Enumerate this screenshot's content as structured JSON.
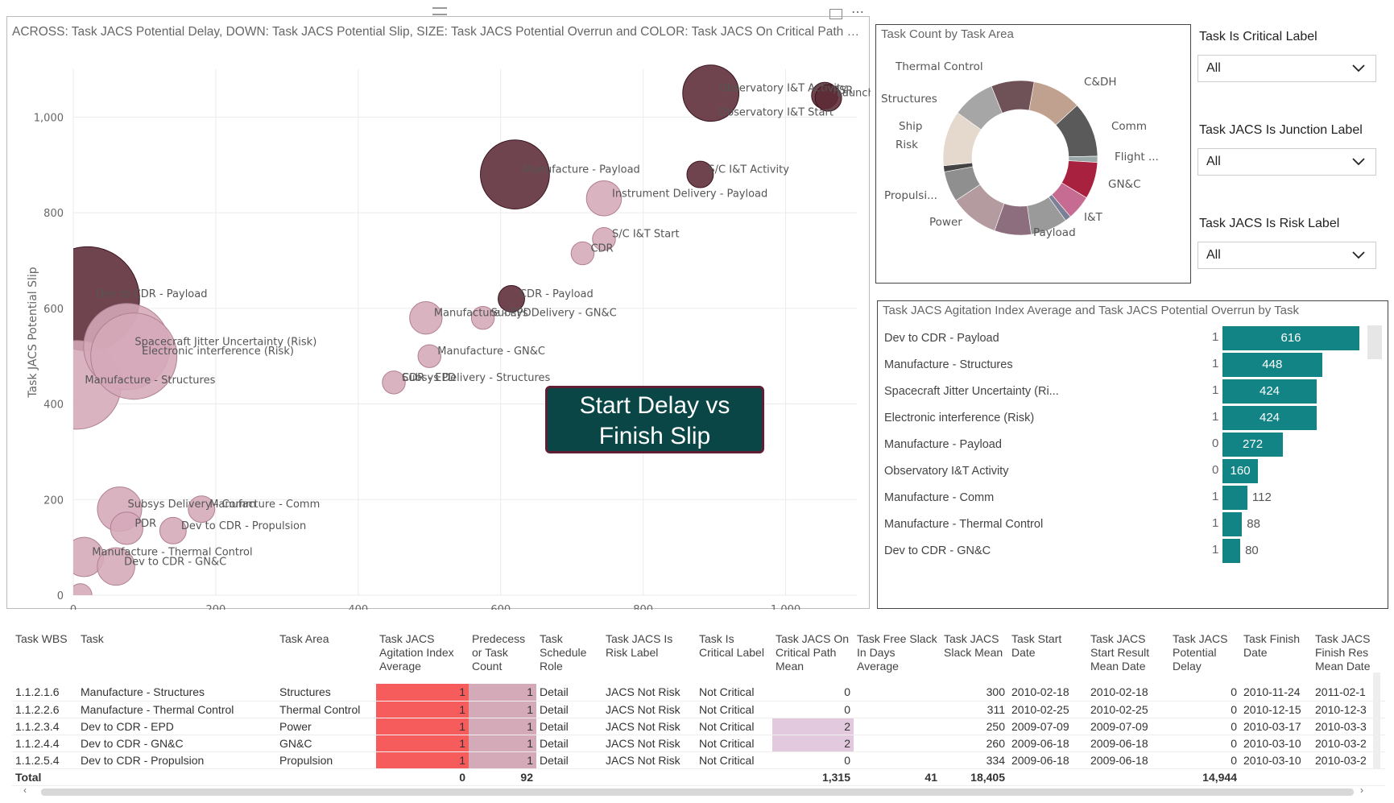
{
  "scatter": {
    "title": "ACROSS: Task JACS Potential Delay, DOWN: Task JACS Potential Slip, SIZE: Task JACS Potential Overrun and COLOR: Task JACS On Critical Path Me...",
    "xlabel": "Task JACS Potential Delay",
    "ylabel": "Task JACS Potential Slip",
    "x_ticks": [
      "0",
      "200",
      "400",
      "600",
      "800",
      "1,000"
    ],
    "y_ticks": [
      "0",
      "200",
      "400",
      "600",
      "800",
      "1,000"
    ],
    "callout_line1": "Start Delay vs",
    "callout_line2": "Finish Slip"
  },
  "chart_data": [
    {
      "type": "scatter",
      "title": "ACROSS: Task JACS Potential Delay, DOWN: Task JACS Potential Slip, SIZE: Task JACS Potential Overrun and COLOR: Task JACS On Critical Path Me...",
      "xlabel": "Task JACS Potential Delay",
      "ylabel": "Task JACS Potential Slip",
      "xlim": [
        0,
        1100
      ],
      "ylim": [
        0,
        1100
      ],
      "points": [
        {
          "label": "Dev to CDR - Payload",
          "x": 20,
          "y": 620,
          "size": 616,
          "color": "#5c2a36"
        },
        {
          "label": "Spacecraft Jitter Uncertainty (Risk)",
          "x": 75,
          "y": 520,
          "size": 424,
          "color": "#d5a8b8"
        },
        {
          "label": "Electronic interference (Risk)",
          "x": 85,
          "y": 500,
          "size": 424,
          "color": "#d5a8b8"
        },
        {
          "label": "Manufacture - Structures",
          "x": 5,
          "y": 440,
          "size": 448,
          "color": "#d5a8b8"
        },
        {
          "label": "Manufacture - Payload",
          "x": 620,
          "y": 880,
          "size": 272,
          "color": "#5c2a36"
        },
        {
          "label": "Observatory I&T Activity",
          "x": 895,
          "y": 1050,
          "size": 180,
          "color": "#5c2a36"
        },
        {
          "label": "Observatory I&T Start",
          "x": 895,
          "y": 1000,
          "size": 0,
          "color": "#5c2a36"
        },
        {
          "label": "PSR",
          "x": 1055,
          "y": 1045,
          "size": 40,
          "color": "#5c2a36"
        },
        {
          "label": "Launch",
          "x": 1060,
          "y": 1040,
          "size": 40,
          "color": "#5c2a36"
        },
        {
          "label": "S/C I&T Activity",
          "x": 880,
          "y": 880,
          "size": 40,
          "color": "#5c2a36"
        },
        {
          "label": "Instrument Delivery - Payload",
          "x": 745,
          "y": 830,
          "size": 70,
          "color": "#d5a8b8"
        },
        {
          "label": "S/C I&T Start",
          "x": 745,
          "y": 745,
          "size": 30,
          "color": "#d5a8b8"
        },
        {
          "label": "CDR",
          "x": 715,
          "y": 715,
          "size": 30,
          "color": "#d5a8b8"
        },
        {
          "label": "CDR - Payload",
          "x": 615,
          "y": 620,
          "size": 40,
          "color": "#5c2a36"
        },
        {
          "label": "Subsys Delivery - GN&C",
          "x": 575,
          "y": 580,
          "size": 30,
          "color": "#d5a8b8"
        },
        {
          "label": "Manufacture - EPD",
          "x": 495,
          "y": 580,
          "size": 60,
          "color": "#d5a8b8"
        },
        {
          "label": "Manufacture - GN&C",
          "x": 500,
          "y": 500,
          "size": 30,
          "color": "#d5a8b8"
        },
        {
          "label": "CDR - EPD",
          "x": 450,
          "y": 445,
          "size": 30,
          "color": "#d5a8b8"
        },
        {
          "label": "Subsys Delivery - Structures",
          "x": 450,
          "y": 445,
          "size": 0,
          "color": "#d5a8b8"
        },
        {
          "label": "Subsys Delivery - Comm",
          "x": 65,
          "y": 180,
          "size": 112,
          "color": "#d5a8b8"
        },
        {
          "label": "PDR",
          "x": 75,
          "y": 140,
          "size": 60,
          "color": "#d5a8b8"
        },
        {
          "label": "Manufacture - Comm",
          "x": 180,
          "y": 180,
          "size": 40,
          "color": "#d5a8b8"
        },
        {
          "label": "Dev to CDR - Propulsion",
          "x": 140,
          "y": 135,
          "size": 40,
          "color": "#d5a8b8"
        },
        {
          "label": "Manufacture - Thermal Control",
          "x": 15,
          "y": 80,
          "size": 88,
          "color": "#d5a8b8"
        },
        {
          "label": "Dev to CDR - GN&C",
          "x": 60,
          "y": 60,
          "size": 80,
          "color": "#d5a8b8"
        },
        {
          "label": "",
          "x": 10,
          "y": 0,
          "size": 30,
          "color": "#d5a8b8"
        }
      ]
    },
    {
      "type": "pie",
      "title": "Task Count by Task Area",
      "categories": [
        "C&DH",
        "Comm",
        "Flight ...",
        "GN&C",
        "I&T",
        "Payload",
        "Power",
        "Propulsi...",
        "Risk",
        "Ship",
        "Structures",
        "Thermal Control"
      ],
      "values": [
        8,
        9,
        1,
        6,
        4,
        1,
        6,
        6,
        8,
        5,
        1,
        9,
        7,
        7
      ],
      "colors": [
        "#c0a08e",
        "#5a5a5a",
        "#9aa7a8",
        "#a8223f",
        "#c66c93",
        "#7c8096",
        "#9a9a9a",
        "#8c6e7e",
        "#b39b9f",
        "#8f8f8f",
        "#444444",
        "#e4d9cc",
        "#a6a6a6",
        "#6e5258"
      ]
    },
    {
      "type": "bar",
      "title": "Task JACS Agitation Index Average and Task JACS Potential Overrun by Task",
      "categories": [
        "Dev to CDR - Payload",
        "Manufacture - Structures",
        "Spacecraft Jitter Uncertainty (Ri...",
        "Electronic interference (Risk)",
        "Manufacture - Payload",
        "Observatory I&T Activity",
        "Manufacture - Comm",
        "Manufacture - Thermal Control",
        "Dev to CDR - GN&C"
      ],
      "series": [
        {
          "name": "Task JACS Agitation Index Average",
          "values": [
            1,
            1,
            1,
            1,
            0,
            0,
            1,
            1,
            1
          ]
        },
        {
          "name": "Task JACS Potential Overrun",
          "values": [
            616,
            448,
            424,
            424,
            272,
            160,
            112,
            88,
            80
          ]
        }
      ]
    }
  ],
  "donut": {
    "title": "Task Count by Task Area",
    "labels": {
      "thermal": "Thermal Control",
      "structures": "Structures",
      "ship": "Ship",
      "risk": "Risk",
      "propulsion": "Propulsi...",
      "power": "Power",
      "payload": "Payload",
      "it": "I&T",
      "gnc": "GN&C",
      "flight": "Flight ...",
      "comm": "Comm",
      "cdh": "C&DH"
    }
  },
  "slicers": [
    {
      "label": "Task Is Critical Label",
      "value": "All"
    },
    {
      "label": "Task JACS Is Junction Label",
      "value": "All"
    },
    {
      "label": "Task JACS Is Risk Label",
      "value": "All"
    }
  ],
  "barchart": {
    "title": "Task JACS Agitation Index Average and Task JACS Potential Overrun by Task",
    "rows": [
      {
        "task": "Dev to CDR - Payload",
        "agit": "1",
        "value": "616",
        "v": 616
      },
      {
        "task": "Manufacture - Structures",
        "agit": "1",
        "value": "448",
        "v": 448
      },
      {
        "task": "Spacecraft Jitter Uncertainty (Ri...",
        "agit": "1",
        "value": "424",
        "v": 424
      },
      {
        "task": "Electronic interference (Risk)",
        "agit": "1",
        "value": "424",
        "v": 424
      },
      {
        "task": "Manufacture - Payload",
        "agit": "0",
        "value": "272",
        "v": 272
      },
      {
        "task": "Observatory I&T Activity",
        "agit": "0",
        "value": "160",
        "v": 160
      },
      {
        "task": "Manufacture - Comm",
        "agit": "1",
        "value": "112",
        "v": 112
      },
      {
        "task": "Manufacture - Thermal Control",
        "agit": "1",
        "value": "88",
        "v": 88
      },
      {
        "task": "Dev to CDR - GN&C",
        "agit": "1",
        "value": "80",
        "v": 80
      }
    ]
  },
  "table": {
    "headers": [
      "Task WBS",
      "Task",
      "Task Area",
      "Task JACS Agitation Index Average",
      "Predecess or Task Count",
      "Task Schedule Role",
      "Task JACS Is Risk Label",
      "Task Is Critical Label",
      "Task JACS On Critical Path Mean",
      "Task Free Slack In Days Average",
      "Task JACS Slack Mean",
      "Task Start Date",
      "Task JACS Start Result Mean Date",
      "Task JACS Potential Delay",
      "Task Finish Date",
      "Task JACS Finish Res Mean Date"
    ],
    "rows": [
      [
        "1.1.2.1.6",
        "Manufacture - Structures",
        "Structures",
        "1",
        "1",
        "Detail",
        "JACS Not Risk",
        "Not Critical",
        "0",
        "",
        "300",
        "2010-02-18",
        "2010-02-18",
        "0",
        "2010-11-24",
        "2011-02-1"
      ],
      [
        "1.1.2.2.6",
        "Manufacture - Thermal Control",
        "Thermal Control",
        "1",
        "1",
        "Detail",
        "JACS Not Risk",
        "Not Critical",
        "0",
        "",
        "311",
        "2010-02-25",
        "2010-02-25",
        "0",
        "2010-12-15",
        "2010-12-3"
      ],
      [
        "1.1.2.3.4",
        "Dev to CDR - EPD",
        "Power",
        "1",
        "1",
        "Detail",
        "JACS Not Risk",
        "Not Critical",
        "2",
        "",
        "250",
        "2009-07-09",
        "2009-07-09",
        "0",
        "2010-03-17",
        "2010-03-3"
      ],
      [
        "1.1.2.4.4",
        "Dev to CDR - GN&C",
        "GN&C",
        "1",
        "1",
        "Detail",
        "JACS Not Risk",
        "Not Critical",
        "2",
        "",
        "260",
        "2009-06-18",
        "2009-06-18",
        "0",
        "2010-03-10",
        "2010-03-2"
      ],
      [
        "1.1.2.5.4",
        "Dev to CDR - Propulsion",
        "Propulsion",
        "1",
        "1",
        "Detail",
        "JACS Not Risk",
        "Not Critical",
        "0",
        "",
        "334",
        "2009-06-18",
        "2009-06-18",
        "0",
        "2010-03-10",
        "2010-03-2"
      ]
    ],
    "total": [
      "Total",
      "",
      "",
      "0",
      "92",
      "",
      "",
      "",
      "1,315",
      "41",
      "18,405",
      "",
      "",
      "14,944",
      "",
      ""
    ]
  },
  "colors": {
    "teal": "#138486",
    "dark_bubble": "#5c2a36",
    "light_bubble": "#d5a8b8",
    "red_cell": "#f75c5c",
    "pink_cell": "#d4a9b8"
  }
}
